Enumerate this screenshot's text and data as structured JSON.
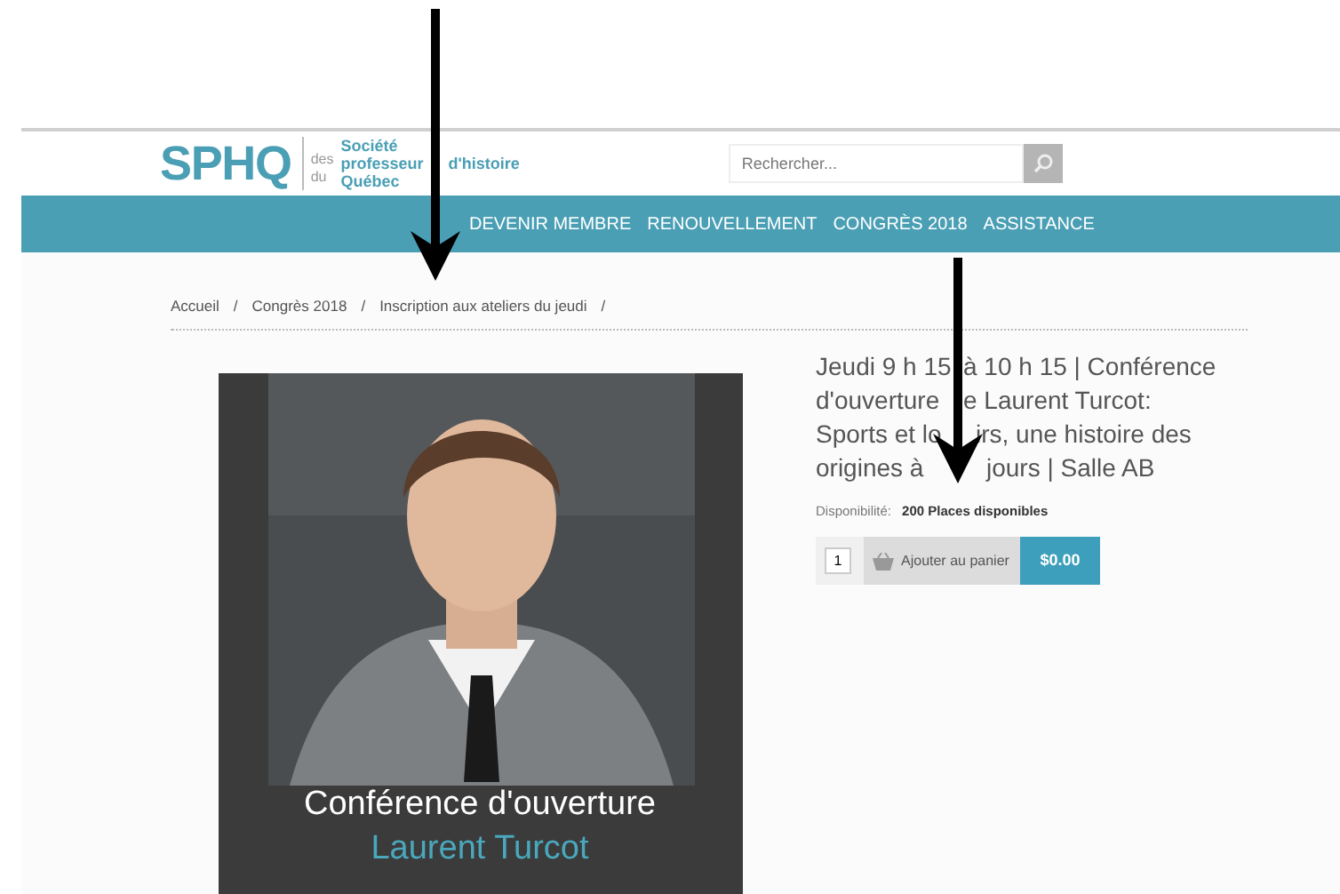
{
  "logo": {
    "mark": "SPHQ",
    "lines": [
      [
        "Société"
      ],
      [
        "professeur",
        "d'histoire"
      ],
      [
        "Québec"
      ]
    ],
    "small_words": [
      "des",
      "du"
    ]
  },
  "search": {
    "placeholder": "Rechercher..."
  },
  "nav": [
    {
      "label": "DEVENIR MEMBRE"
    },
    {
      "label": "RENOUVELLEMENT"
    },
    {
      "label": "CONGRÈS 2018"
    },
    {
      "label": "ASSISTANCE"
    }
  ],
  "breadcrumb": {
    "separator": "/",
    "items": [
      "Accueil",
      "Congrès 2018",
      "Inscription aux ateliers du jeudi"
    ]
  },
  "product": {
    "image": {
      "kind": "picture",
      "caption": "Conférence d'ouverture",
      "speaker": "Laurent Turcot"
    },
    "title_lines": [
      [
        "Jeudi 9 h 15",
        "à 10 h 15 | Conférence"
      ],
      [
        "d'ouverture",
        "e Laurent Turcot:"
      ],
      [
        "Sports et lo",
        "irs, une histoire des"
      ],
      [
        "origines à",
        "jours | Salle AB"
      ]
    ],
    "availability_label": "Disponibilité:",
    "availability": "200 Places disponibles",
    "quantity": "1",
    "add_to_cart": "Ajouter au panier",
    "price": "$0.00"
  },
  "annotations": [
    {
      "kind": "arrow"
    },
    {
      "kind": "arrow"
    }
  ]
}
